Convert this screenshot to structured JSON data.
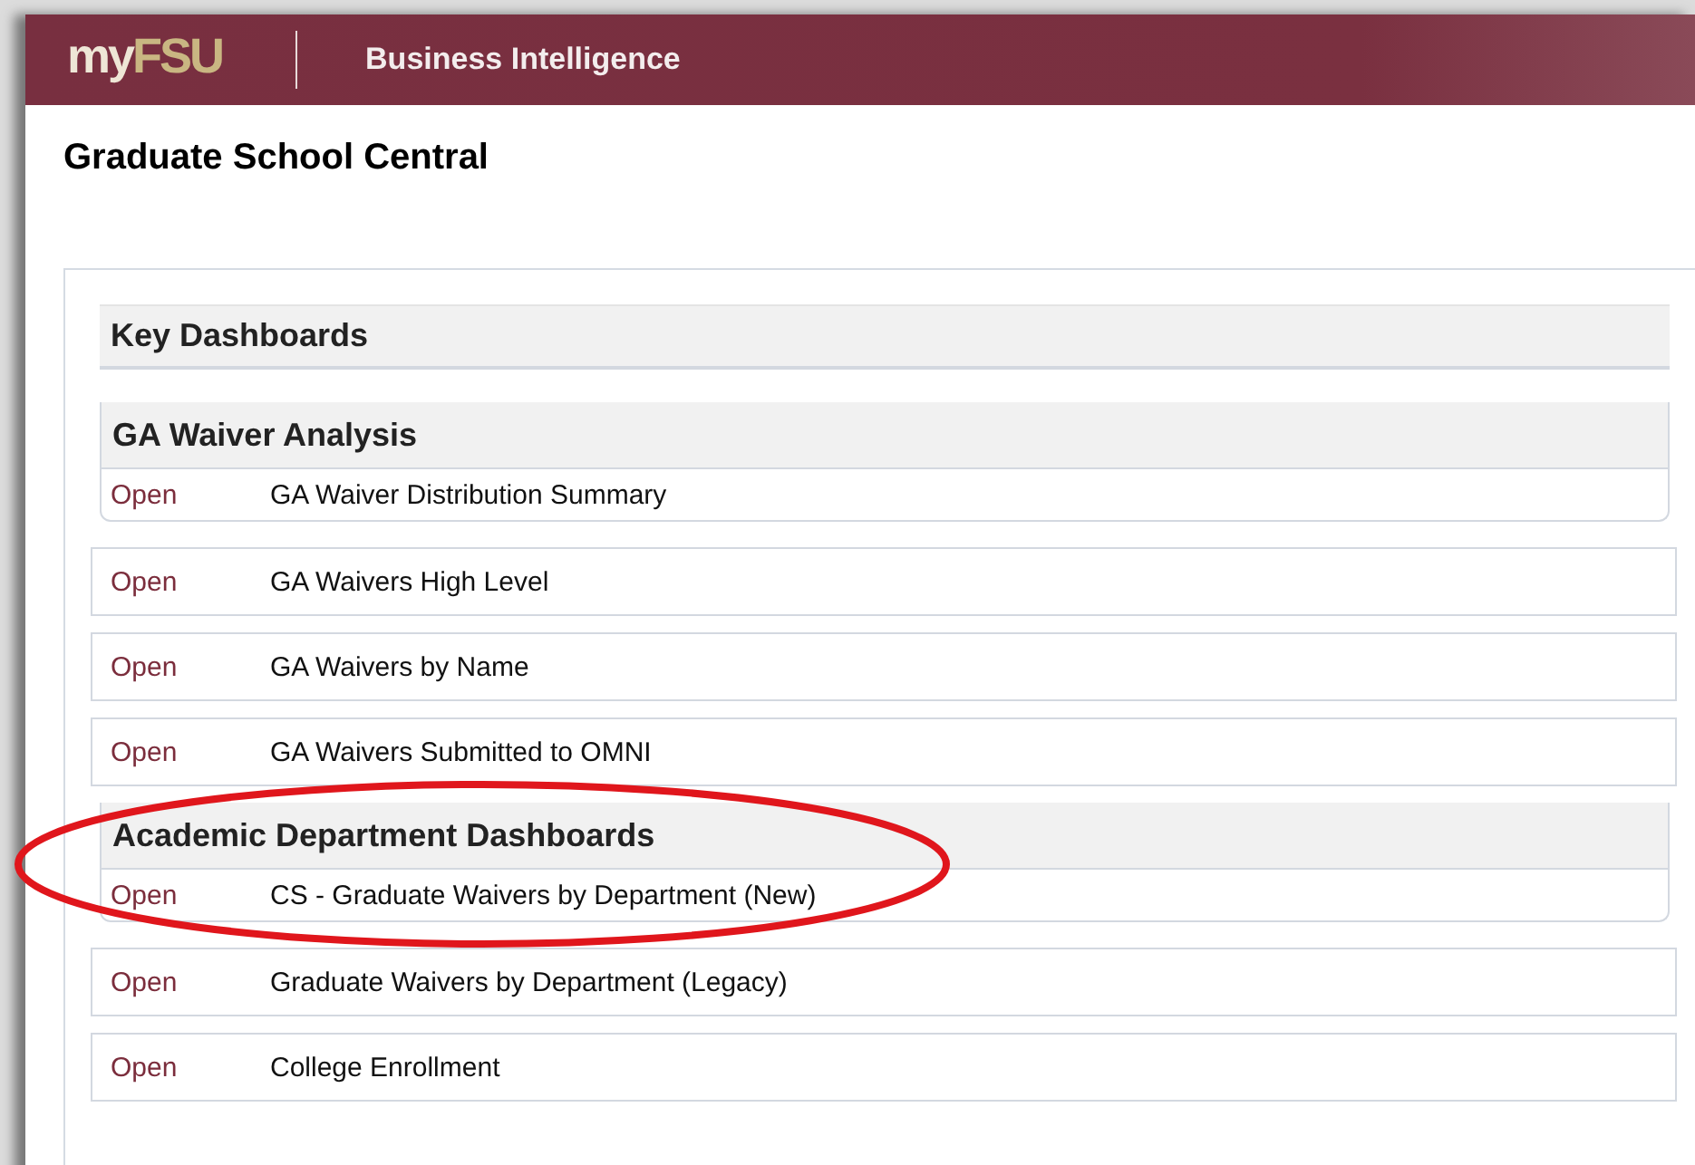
{
  "header": {
    "logo": {
      "prefix": "my",
      "main": "FSU"
    },
    "app_title": "Business Intelligence"
  },
  "page_title": "Graduate School Central",
  "items": [
    {
      "kind": "heading",
      "title": "Key Dashboards"
    },
    {
      "kind": "group",
      "title": "GA Waiver Analysis",
      "highlighted": false,
      "reports": [
        {
          "link": "Open",
          "name": "GA Waiver Distribution Summary"
        }
      ]
    },
    {
      "kind": "report",
      "link": "Open",
      "name": "GA Waivers High Level"
    },
    {
      "kind": "report",
      "link": "Open",
      "name": "GA Waivers by Name"
    },
    {
      "kind": "report",
      "link": "Open",
      "name": "GA Waivers Submitted to OMNI"
    },
    {
      "kind": "group",
      "title": "Academic Department Dashboards",
      "highlighted": true,
      "reports": [
        {
          "link": "Open",
          "name": "CS - Graduate Waivers by Department (New)"
        }
      ]
    },
    {
      "kind": "report",
      "link": "Open",
      "name": "Graduate Waivers by Department (Legacy)"
    },
    {
      "kind": "report",
      "link": "Open",
      "name": "College Enrollment"
    }
  ]
}
